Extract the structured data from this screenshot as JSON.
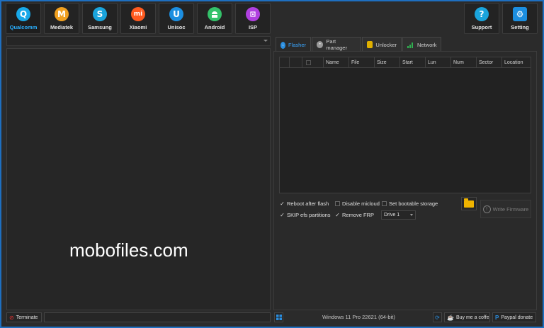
{
  "vendors": [
    {
      "label": "Qualcomm",
      "glyph": "Q",
      "color": "#18a8e8",
      "icon": "qualcomm-icon"
    },
    {
      "label": "Mediatek",
      "glyph": "M",
      "color": "#f0a020",
      "icon": "mediatek-icon"
    },
    {
      "label": "Samsung",
      "glyph": "S",
      "color": "#1aa4dc",
      "icon": "samsung-icon"
    },
    {
      "label": "Xiaomi",
      "glyph": "mi",
      "color": "#ff5a1f",
      "icon": "xiaomi-icon"
    },
    {
      "label": "Unisoc",
      "glyph": "U",
      "color": "#1c8ee0",
      "icon": "unisoc-icon"
    },
    {
      "label": "Android",
      "glyph": "A",
      "color": "#34c26a",
      "icon": "android-icon"
    },
    {
      "label": "ISP",
      "glyph": "▣",
      "color": "#b040e0",
      "icon": "chip-icon"
    }
  ],
  "right_tools": [
    {
      "label": "Support",
      "glyph": "?",
      "color": "#1aa4dc",
      "icon": "help-icon"
    },
    {
      "label": "Setting",
      "glyph": "⚙",
      "color": "#1c8ee0",
      "icon": "gear-icon"
    }
  ],
  "tabs": [
    {
      "label": "Flasher",
      "icon": "download-icon",
      "color": "#2a8ee0"
    },
    {
      "label": "Part manager",
      "icon": "disk-icon",
      "color": "#9a9a9a"
    },
    {
      "label": "Unlocker",
      "icon": "lock-icon",
      "color": "#e0b000"
    },
    {
      "label": "Network",
      "icon": "signal-icon",
      "color": "#30b050"
    }
  ],
  "table": {
    "columns": [
      "Name",
      "File",
      "Size",
      "Start",
      "Lun",
      "Num",
      "Sector",
      "Location"
    ]
  },
  "options": {
    "reboot_after_flash": {
      "label": "Reboot after flash",
      "checked": true
    },
    "disable_micloud": {
      "label": "Disable micloud",
      "checked": false
    },
    "set_bootable_storage": {
      "label": "Set bootable storage",
      "checked": false
    },
    "skip_efs": {
      "label": "SKIP efs partitions",
      "checked": true
    },
    "remove_frp": {
      "label": "Remove FRP",
      "checked": true
    }
  },
  "drive_select": {
    "value": "Drive 1"
  },
  "write_firmware_label": "Write Firmware",
  "status": {
    "terminate_label": "Terminate",
    "os_text": "Windows 11 Pro 22621 (64-bit)",
    "coffee_label": "Buy me a coffe",
    "paypal_label": "Paypal donate"
  },
  "watermark": "mobofiles.com",
  "colors": {
    "accent": "#1e6fc0",
    "active_label": "#2ab0ff"
  }
}
